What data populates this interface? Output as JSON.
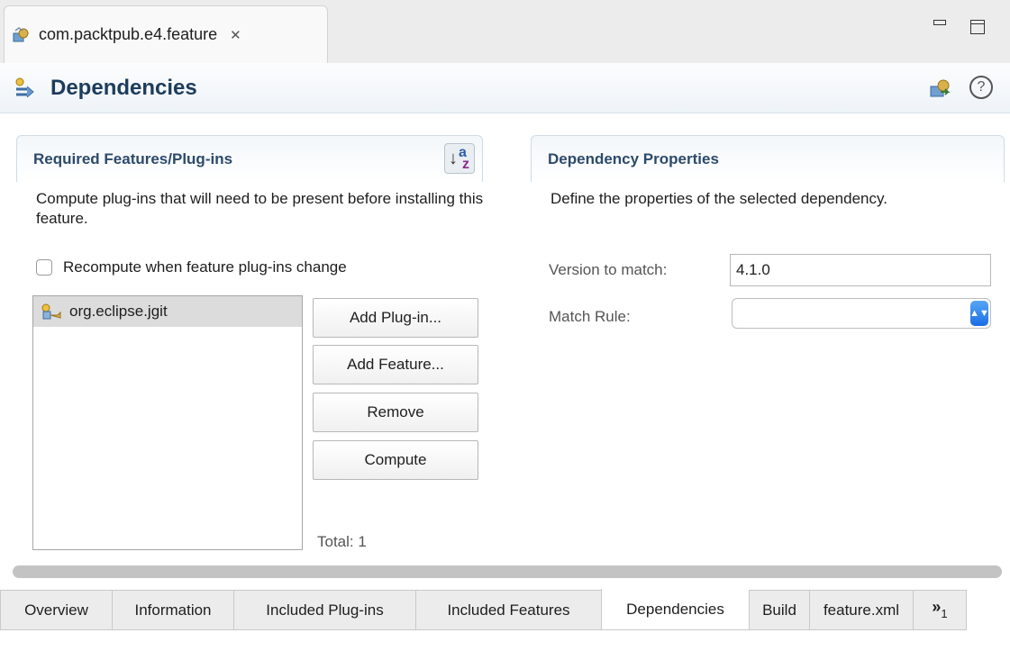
{
  "editor": {
    "tab_title": "com.packtpub.e4.feature",
    "close_glyph": "✕",
    "icons": {
      "tab": "feature-editor-icon",
      "close": "close-icon",
      "minimize": "minimize-icon",
      "maximize": "maximize-icon"
    }
  },
  "header": {
    "title": "Dependencies",
    "icons": [
      "dependencies-icon",
      "export-feature-icon",
      "help-icon"
    ],
    "help_glyph": "?"
  },
  "required": {
    "title": "Required Features/Plug-ins",
    "sort_icon": "sort-alphabetical-icon",
    "sort_glyph_a": "a",
    "sort_glyph_z": "z",
    "description": "Compute plug-ins that will need to be present before installing this feature.",
    "recompute_label": "Recompute when feature plug-ins change",
    "recompute_checked": false,
    "items": [
      {
        "label": "org.eclipse.jgit",
        "icon": "plugin-icon"
      }
    ],
    "buttons": {
      "add_plugin": "Add Plug-in...",
      "add_feature": "Add Feature...",
      "remove": "Remove",
      "compute": "Compute"
    },
    "total": "Total: 1"
  },
  "properties": {
    "title": "Dependency Properties",
    "description": "Define the properties of the selected dependency.",
    "version_label": "Version to match:",
    "version_value": "4.1.0",
    "match_rule_label": "Match Rule:",
    "match_rule_value": "",
    "combo_arrows": "▲▼"
  },
  "page_tabs": [
    {
      "label": "Overview",
      "active": false
    },
    {
      "label": "Information",
      "active": false
    },
    {
      "label": "Included Plug-ins",
      "active": false
    },
    {
      "label": "Included Features",
      "active": false
    },
    {
      "label": "Dependencies",
      "active": true
    },
    {
      "label": "Build",
      "active": false
    },
    {
      "label": "feature.xml",
      "active": false
    }
  ],
  "overflow": {
    "chevron": "»",
    "count": "1"
  },
  "colors": {
    "header_title": "#1c3c5c",
    "section_title": "#2d4a6b",
    "selection": "#dcdcdc",
    "combo_accent": "#1b6ee6"
  }
}
